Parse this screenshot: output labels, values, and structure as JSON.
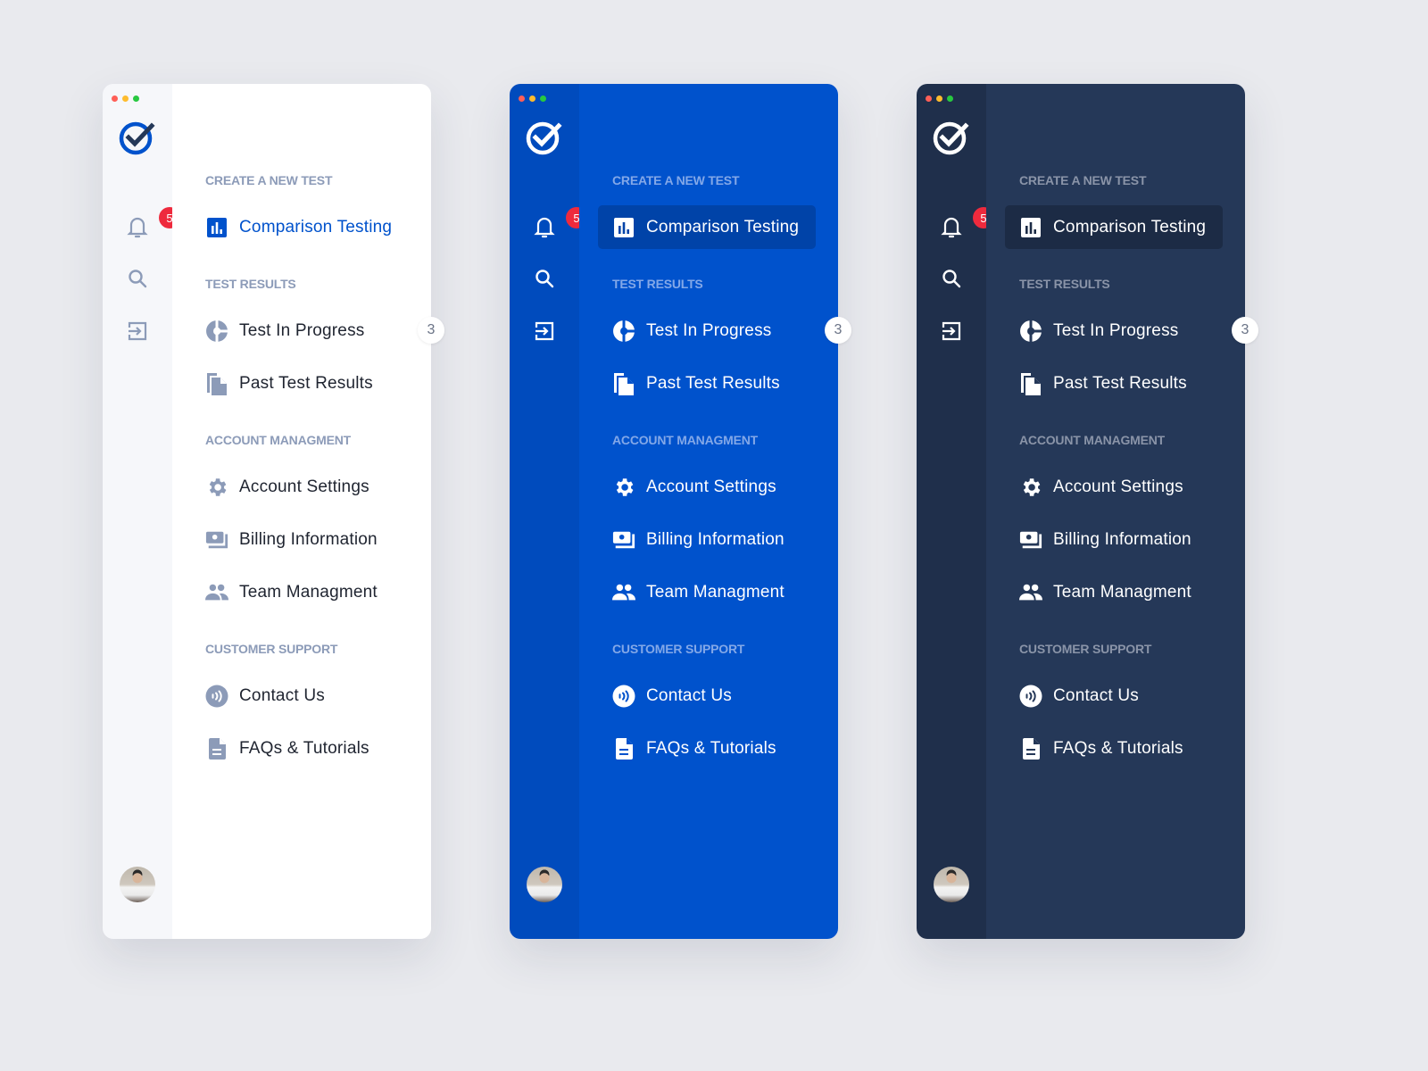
{
  "colors": {
    "background": "#e9eaee",
    "brand_blue": "#0052cc",
    "navy": "#253858",
    "badge_red": "#ee2a3d",
    "dot_red": "#ff5f57",
    "dot_yellow": "#febc2e",
    "dot_green": "#28c840"
  },
  "themes": [
    "light",
    "blue",
    "dark"
  ],
  "notifications": {
    "count": "5"
  },
  "nav": {
    "sections": [
      {
        "title": "CREATE A NEW TEST",
        "items": [
          {
            "label": "Comparison Testing",
            "icon": "bar-chart-icon",
            "active": true
          }
        ]
      },
      {
        "title": "TEST RESULTS",
        "items": [
          {
            "label": "Test In Progress",
            "icon": "pie-progress-icon",
            "count": "3"
          },
          {
            "label": "Past Test Results",
            "icon": "documents-icon"
          }
        ]
      },
      {
        "title": "ACCOUNT MANAGMENT",
        "items": [
          {
            "label": "Account Settings",
            "icon": "gear-icon"
          },
          {
            "label": "Billing Information",
            "icon": "billing-icon"
          },
          {
            "label": "Team Managment",
            "icon": "team-icon"
          }
        ]
      },
      {
        "title": "CUSTOMER SUPPORT",
        "items": [
          {
            "label": "Contact Us",
            "icon": "contact-icon"
          },
          {
            "label": "FAQs & Tutorials",
            "icon": "document-icon"
          }
        ]
      }
    ]
  }
}
